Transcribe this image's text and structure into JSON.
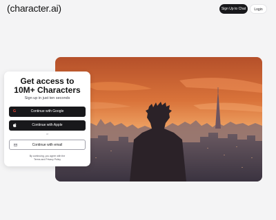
{
  "header": {
    "logo": "(character.ai)",
    "signup_label": "Sign Up to Chat",
    "login_label": "Login"
  },
  "signup_card": {
    "title_line1": "Get access to",
    "title_line2": "10M+ Characters",
    "subtitle": "Sign up in just ten seconds",
    "google_label": "Continue with Google",
    "apple_label": "Continue with Apple",
    "divider": "or",
    "email_label": "Continue with email",
    "terms_line1": "By continuing, you agree with the",
    "terms_line2": "Terms and Privacy Policy"
  },
  "colors": {
    "background": "#f4f4f5",
    "button_dark": "#18181b",
    "sky_top": "#c4602a",
    "sky_horizon": "#f0b071"
  }
}
